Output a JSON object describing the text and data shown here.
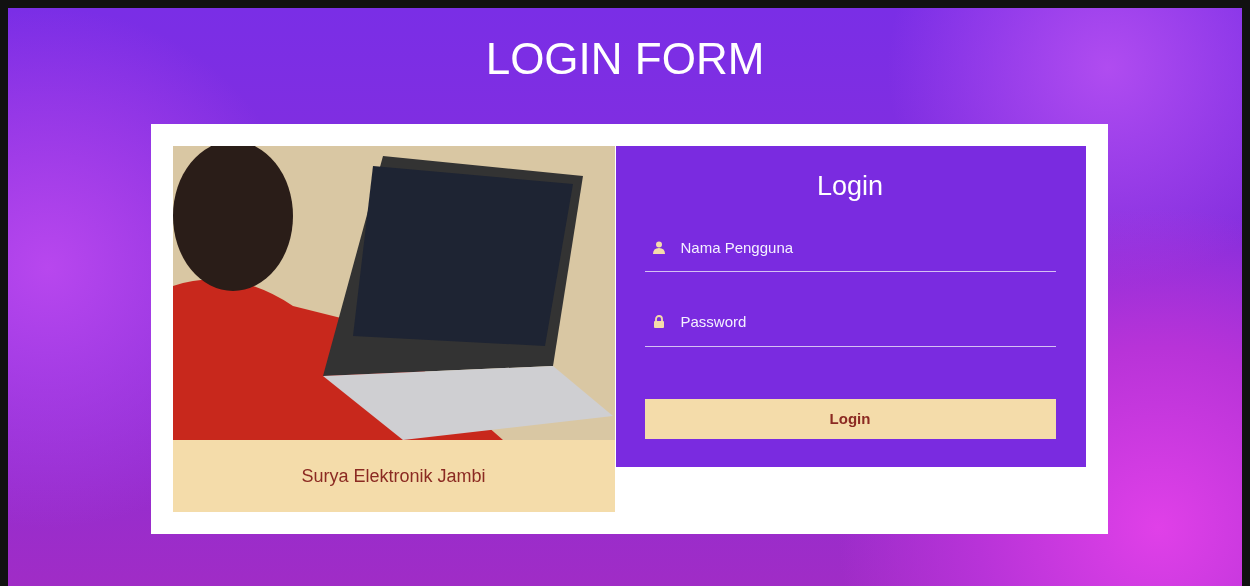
{
  "page_title": "LOGIN FORM",
  "brand": {
    "caption": "Surya Elektronik Jambi"
  },
  "login": {
    "title": "Login",
    "fields": [
      {
        "kind": "user",
        "placeholder": "Nama Pengguna"
      },
      {
        "kind": "password",
        "placeholder": "Password"
      }
    ],
    "button": "Login"
  }
}
